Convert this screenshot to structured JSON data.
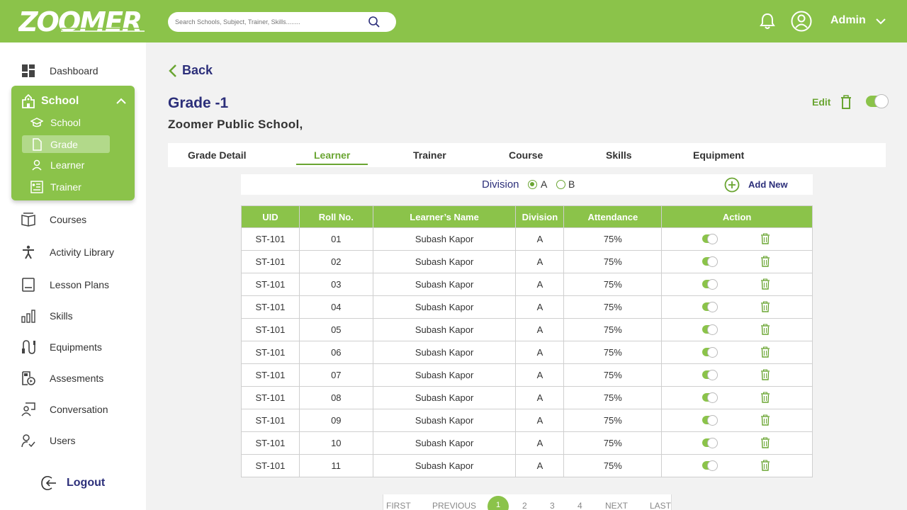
{
  "header": {
    "logo": "ZOOMER",
    "search_placeholder": "Search Schools, Subject, Trainer, Skills........",
    "user": "Admin"
  },
  "sidebar": {
    "items": [
      {
        "label": "Dashboard",
        "icon": "dashboard-icon"
      },
      {
        "label": "Courses",
        "icon": "book-icon"
      },
      {
        "label": "Activity Library",
        "icon": "person-icon"
      },
      {
        "label": "Lesson Plans",
        "icon": "notebook-icon"
      },
      {
        "label": "Skills",
        "icon": "bar-chart-icon"
      },
      {
        "label": "Equipments",
        "icon": "equipment-icon"
      },
      {
        "label": "Assesments",
        "icon": "assessment-icon"
      },
      {
        "label": "Conversation",
        "icon": "conversation-icon"
      },
      {
        "label": "Users",
        "icon": "users-icon"
      }
    ],
    "school_group": {
      "label": "School",
      "sub_items": [
        "School",
        "Grade",
        "Learner",
        "Trainer"
      ],
      "active": "Grade"
    },
    "logout": "Logout"
  },
  "main": {
    "back": "Back",
    "title": "Grade -1",
    "school_name": "Zoomer Public School,",
    "edit": "Edit",
    "tabs": [
      "Grade Detail",
      "Learner",
      "Trainer",
      "Course",
      "Skills",
      "Equipment"
    ],
    "active_tab": "Learner",
    "division_label": "Division",
    "division_options": [
      "A",
      "B"
    ],
    "division_selected": "A",
    "add_new": "Add New",
    "table": {
      "columns": [
        "UID",
        "Roll No.",
        "Learner’s Name",
        "Division",
        "Attendance",
        "Action"
      ],
      "rows": [
        [
          "ST-101",
          "01",
          "Subash Kapor",
          "A",
          "75%"
        ],
        [
          "ST-101",
          "02",
          "Subash Kapor",
          "A",
          "75%"
        ],
        [
          "ST-101",
          "03",
          "Subash Kapor",
          "A",
          "75%"
        ],
        [
          "ST-101",
          "04",
          "Subash Kapor",
          "A",
          "75%"
        ],
        [
          "ST-101",
          "05",
          "Subash Kapor",
          "A",
          "75%"
        ],
        [
          "ST-101",
          "06",
          "Subash Kapor",
          "A",
          "75%"
        ],
        [
          "ST-101",
          "07",
          "Subash Kapor",
          "A",
          "75%"
        ],
        [
          "ST-101",
          "08",
          "Subash Kapor",
          "A",
          "75%"
        ],
        [
          "ST-101",
          "09",
          "Subash Kapor",
          "A",
          "75%"
        ],
        [
          "ST-101",
          "10",
          "Subash Kapor",
          "A",
          "75%"
        ],
        [
          "ST-101",
          "11",
          "Subash Kapor",
          "A",
          "75%"
        ]
      ]
    },
    "pagination": {
      "first": "FIRST",
      "previous": "PREVIOUS",
      "pages": [
        "1",
        "2",
        "3",
        "4"
      ],
      "current": "1",
      "next": "NEXT",
      "last": "LAST"
    }
  },
  "colors": {
    "brand_green": "#8bc34a",
    "accent_green": "#6aa532",
    "navy": "#2c2f7a"
  }
}
